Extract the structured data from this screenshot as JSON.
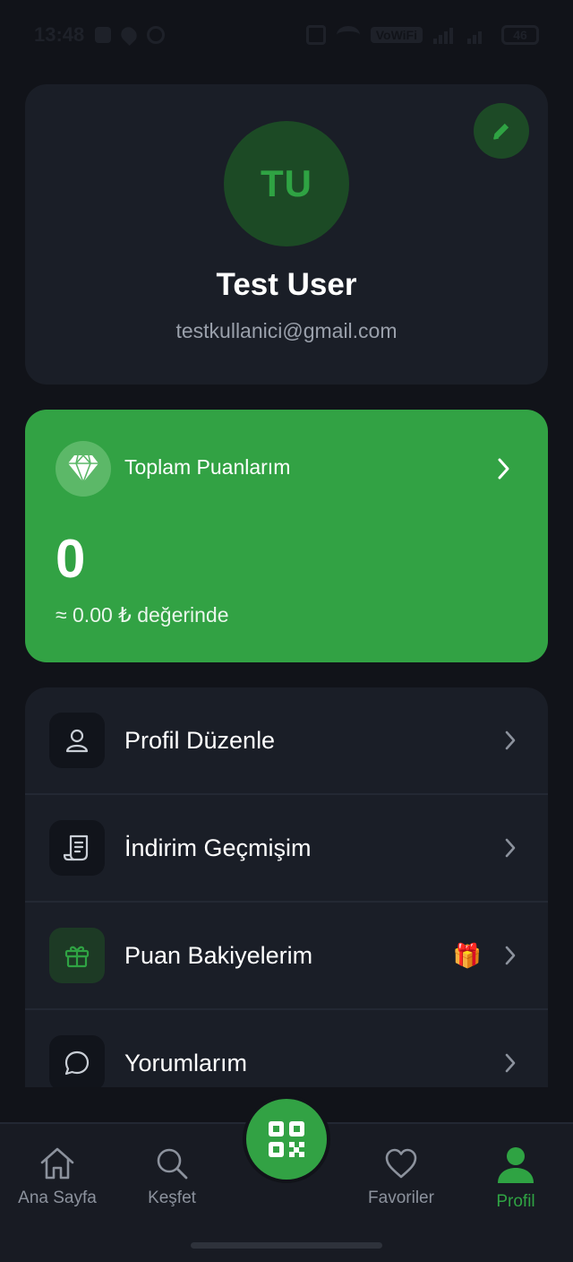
{
  "status_bar": {
    "time": "13:48",
    "network_badge": "VoWiFi",
    "battery": "46"
  },
  "profile": {
    "initials": "TU",
    "name": "Test User",
    "email": "testkullanici@gmail.com",
    "edit_icon": "pencil-icon"
  },
  "points": {
    "title": "Toplam Puanlarım",
    "value": "0",
    "worth": "≈ 0.00 ₺ değerinde",
    "icon": "diamond-icon"
  },
  "menu": {
    "items": [
      {
        "label": "Profil Düzenle",
        "icon": "user-icon"
      },
      {
        "label": "İndirim Geçmişim",
        "icon": "receipt-icon"
      },
      {
        "label": "Puan Bakiyelerim",
        "icon": "gift-icon",
        "badge": "🎁"
      },
      {
        "label": "Yorumlarım",
        "icon": "chat-icon"
      }
    ]
  },
  "nav": {
    "items": [
      {
        "label": "Ana Sayfa",
        "icon": "home-icon"
      },
      {
        "label": "Keşfet",
        "icon": "search-icon"
      },
      {
        "label": "Favoriler",
        "icon": "heart-icon"
      },
      {
        "label": "Profil",
        "icon": "profile-icon",
        "active": true
      }
    ],
    "center_icon": "qr-code-icon"
  },
  "colors": {
    "accent": "#32a244",
    "background": "#111319",
    "card": "#1a1e27"
  }
}
